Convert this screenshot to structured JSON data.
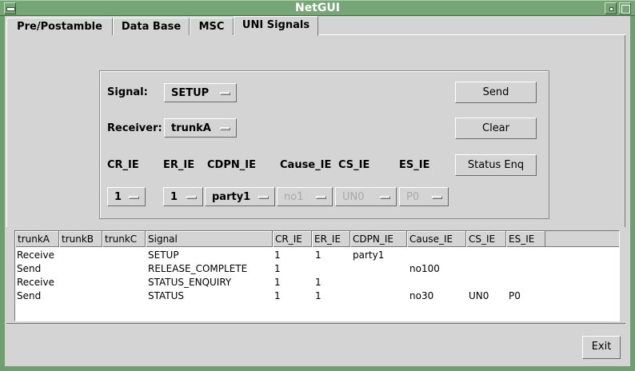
{
  "window": {
    "title": "NetGUI"
  },
  "tabs": [
    {
      "label": "Pre/Postamble"
    },
    {
      "label": "Data Base"
    },
    {
      "label": "MSC"
    },
    {
      "label": "UNI Signals"
    }
  ],
  "active_tab": "UNI Signals",
  "form": {
    "signal_label": "Signal:",
    "signal_value": "SETUP",
    "receiver_label": "Receiver:",
    "receiver_value": "trunkA",
    "ie_labels": [
      "CR_IE",
      "ER_IE",
      "CDPN_IE",
      "Cause_IE",
      "CS_IE",
      "ES_IE"
    ],
    "ie_values": [
      "1",
      "1",
      "party1",
      "no1",
      "UN0",
      "P0"
    ],
    "ie_enabled": [
      true,
      true,
      true,
      false,
      false,
      false
    ],
    "send_label": "Send",
    "clear_label": "Clear",
    "status_enq_label": "Status Enq"
  },
  "table": {
    "columns": [
      "trunkA",
      "trunkB",
      "trunkC",
      "Signal",
      "CR_IE",
      "ER_IE",
      "CDPN_IE",
      "Cause_IE",
      "CS_IE",
      "ES_IE"
    ],
    "rows": [
      [
        "Receive",
        "",
        "",
        "SETUP",
        "1",
        "1",
        "party1",
        "",
        "",
        ""
      ],
      [
        "Send",
        "",
        "",
        "RELEASE_COMPLETE",
        "1",
        "",
        "",
        "no100",
        "",
        ""
      ],
      [
        "Receive",
        "",
        "",
        "STATUS_ENQUIRY",
        "1",
        "1",
        "",
        "",
        "",
        ""
      ],
      [
        "Send",
        "",
        "",
        "STATUS",
        "1",
        "1",
        "",
        "no30",
        "UN0",
        "P0"
      ]
    ]
  },
  "exit_label": "Exit"
}
